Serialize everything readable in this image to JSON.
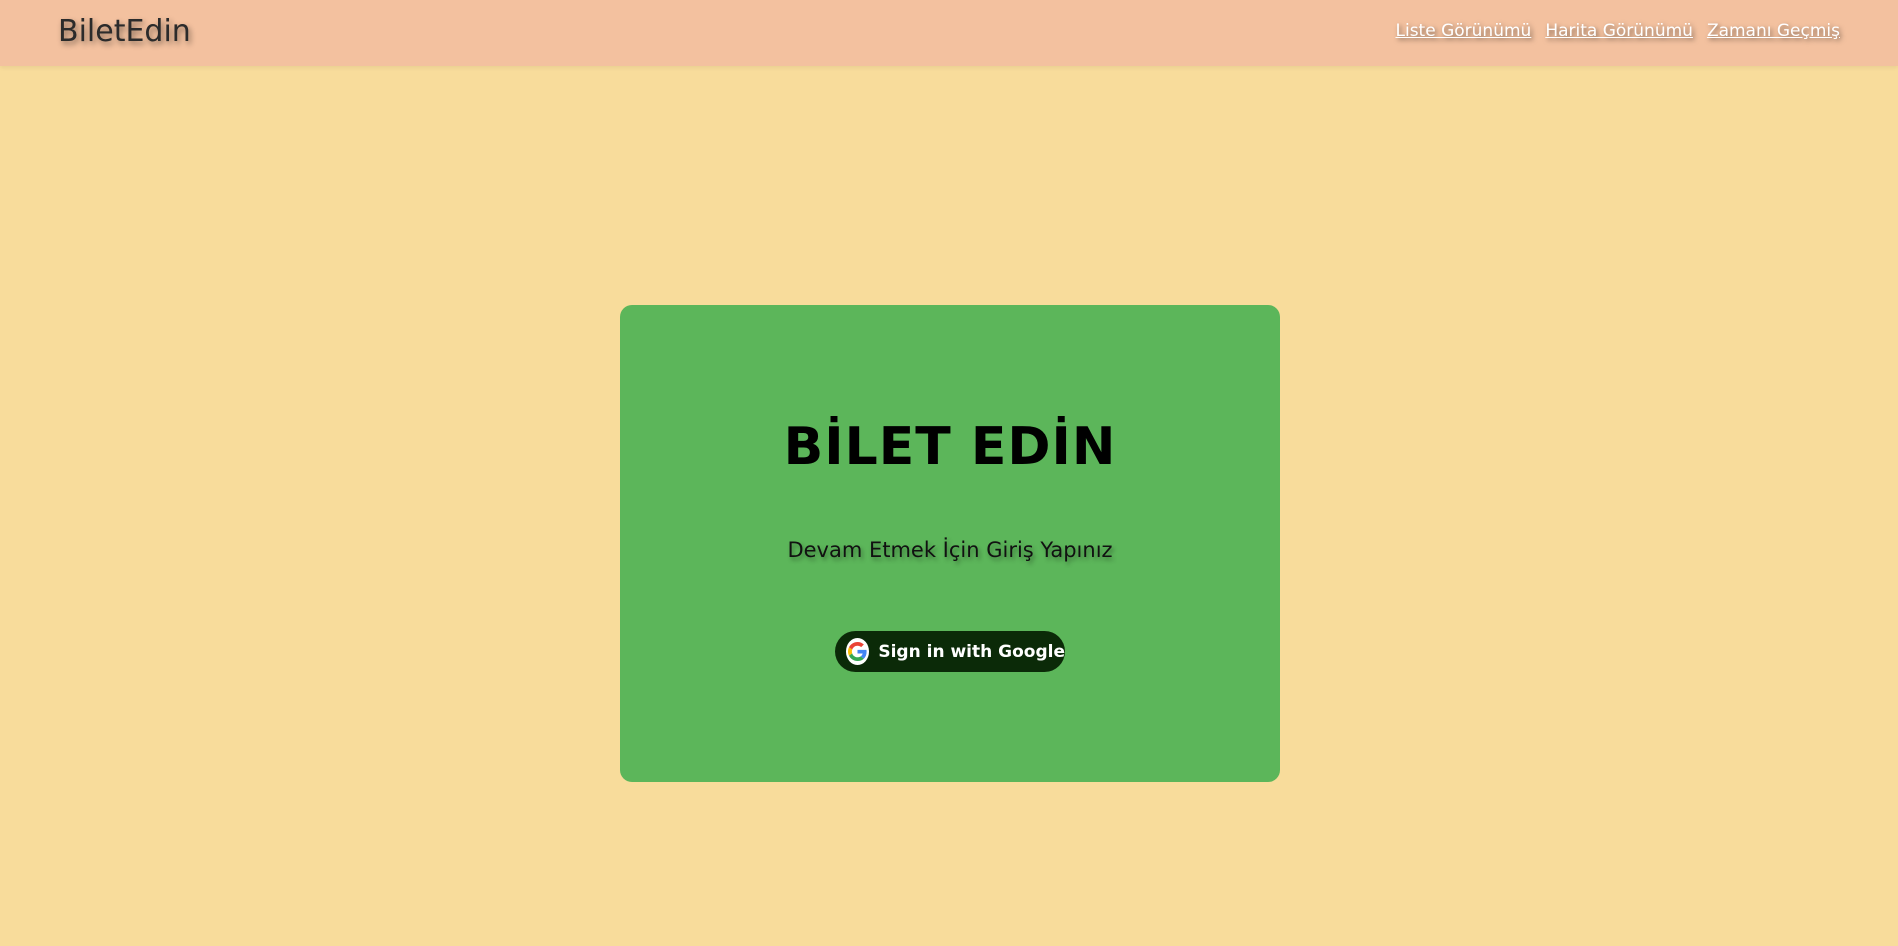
{
  "navbar": {
    "brand": "BiletEdin",
    "links": [
      {
        "label": "Liste Görünümü"
      },
      {
        "label": "Harita Görünümü"
      },
      {
        "label": "Zamanı Geçmiş"
      }
    ]
  },
  "login_card": {
    "title": "BİLET EDİN",
    "subtitle": "Devam Etmek İçin Giriş Yapınız",
    "google_button": {
      "label": "Sign in with Google",
      "icon": "google-icon"
    }
  },
  "colors": {
    "page_background": "#F8DC9B",
    "navbar_background": "#F3C19F",
    "card_background": "#5CB65A",
    "button_background": "#0B2A08"
  }
}
